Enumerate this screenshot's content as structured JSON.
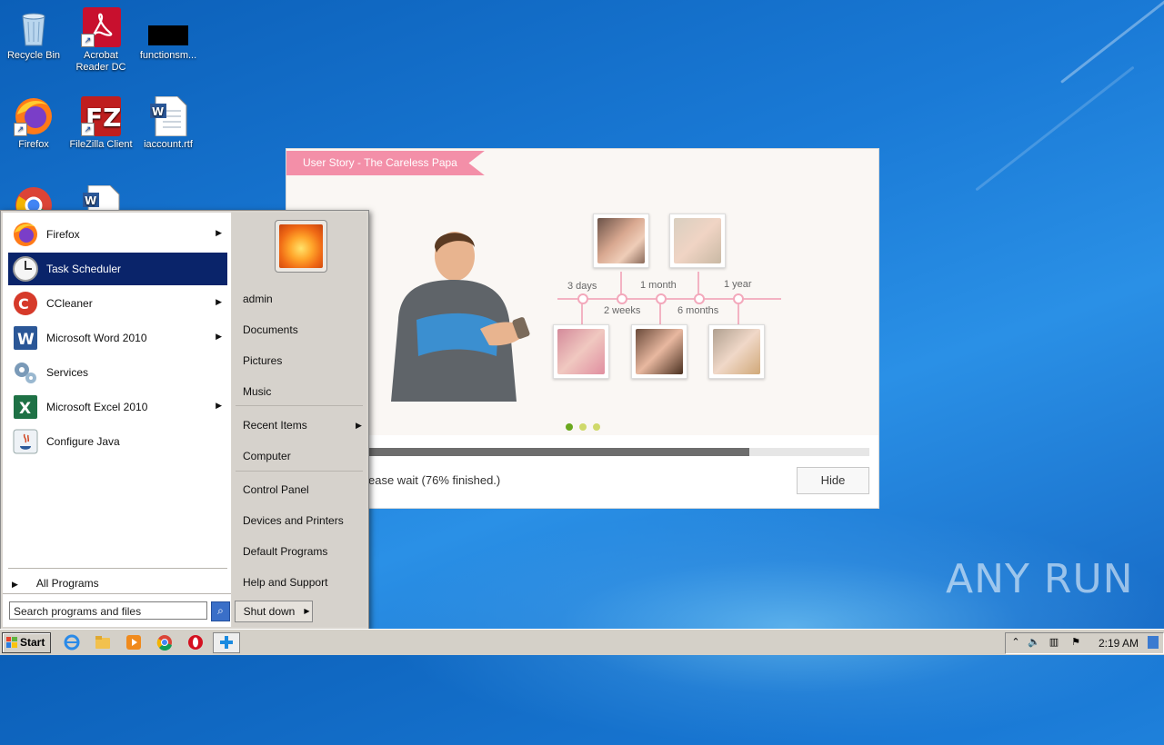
{
  "desktop": {
    "icons": [
      {
        "label": "Recycle Bin",
        "icon": "recycle-bin-icon"
      },
      {
        "label": "Acrobat Reader DC",
        "icon": "acrobat-icon"
      },
      {
        "label": "functionsm...",
        "icon": "black-file-icon"
      },
      {
        "label": "Firefox",
        "icon": "firefox-icon"
      },
      {
        "label": "FileZilla Client",
        "icon": "filezilla-icon"
      },
      {
        "label": "iaccount.rtf",
        "icon": "word-doc-icon"
      }
    ]
  },
  "installer": {
    "ribbon_title": "User Story - The Careless Papa",
    "timeline": {
      "top_labels": [
        "3 days",
        "1 month",
        "1 year"
      ],
      "bottom_labels": [
        "2 weeks",
        "6 months"
      ]
    },
    "carousel_active": 0,
    "progress_percent": 76,
    "status_text": "ease wait (76% finished.)",
    "hide_label": "Hide",
    "colors": {
      "accent": "#f38fa8",
      "dot_active": "#6aa81e",
      "dot_inactive": "#cfd96a"
    }
  },
  "start_menu": {
    "programs": [
      {
        "label": "Firefox",
        "icon": "firefox-icon",
        "has_arrow": true
      },
      {
        "label": "Task Scheduler",
        "icon": "clock-icon",
        "has_arrow": false,
        "selected": true
      },
      {
        "label": "CCleaner",
        "icon": "ccleaner-icon",
        "has_arrow": true
      },
      {
        "label": "Microsoft Word 2010",
        "icon": "word-icon",
        "has_arrow": true
      },
      {
        "label": "Services",
        "icon": "gears-icon",
        "has_arrow": false
      },
      {
        "label": "Microsoft Excel 2010",
        "icon": "excel-icon",
        "has_arrow": true
      },
      {
        "label": "Configure Java",
        "icon": "java-icon",
        "has_arrow": false
      }
    ],
    "all_programs": "All Programs",
    "search_placeholder": "Search programs and files",
    "right": {
      "user": "admin",
      "documents": "Documents",
      "pictures": "Pictures",
      "music": "Music",
      "recent_items": "Recent Items",
      "computer": "Computer",
      "control_panel": "Control Panel",
      "devices_printers": "Devices and Printers",
      "default_programs": "Default Programs",
      "help_support": "Help and Support"
    },
    "shutdown": "Shut down"
  },
  "taskbar": {
    "start_label": "Start",
    "pinned": [
      "ie-icon",
      "explorer-icon",
      "media-player-icon",
      "chrome-icon",
      "opera-icon",
      "installer-icon"
    ],
    "clock": "2:19 AM"
  },
  "watermark": "ANY RUN"
}
